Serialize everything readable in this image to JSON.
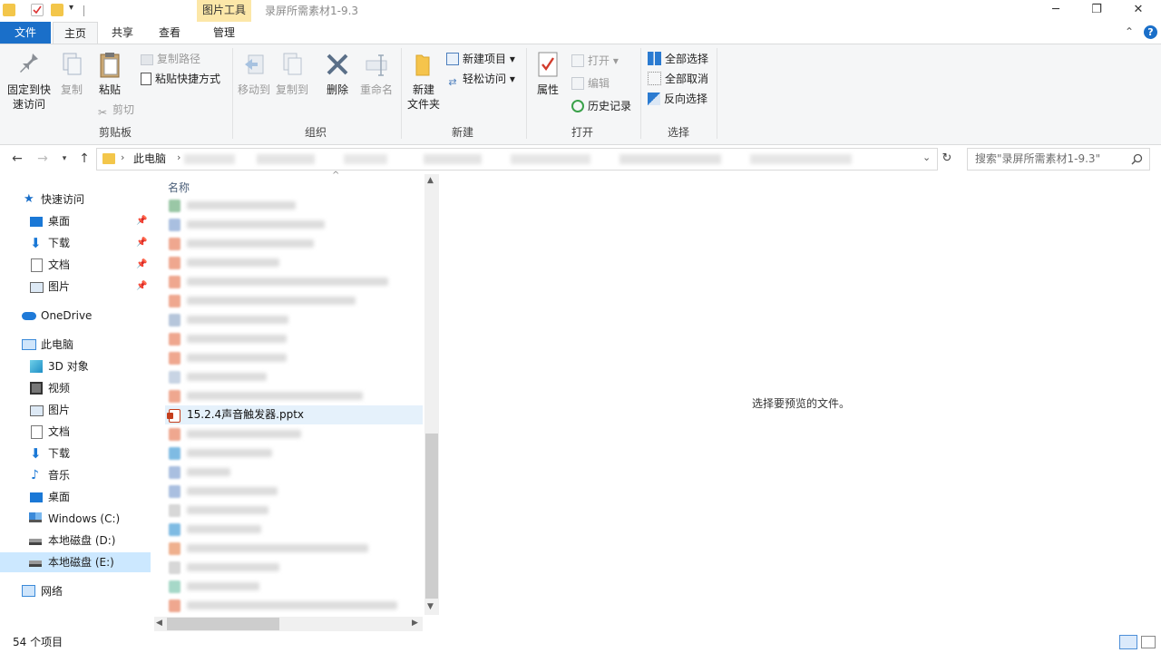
{
  "titlebar": {
    "context_tab": "图片工具",
    "title": "录屏所需素材1-9.3",
    "minimize": "─",
    "maximize": "❐",
    "close": "✕"
  },
  "tabs": {
    "file": "文件",
    "home": "主页",
    "share": "共享",
    "view": "查看",
    "manage": "管理",
    "collapse": "⌃",
    "help": "?"
  },
  "ribbon": {
    "clipboard": {
      "pin": "固定到快速访问",
      "pin_line1": "固定到快",
      "pin_line2": "速访问",
      "copy": "复制",
      "paste": "粘贴",
      "copy_path": "复制路径",
      "paste_shortcut": "粘贴快捷方式",
      "cut": "剪切",
      "label": "剪贴板"
    },
    "organize": {
      "move_to": "移动到",
      "copy_to": "复制到",
      "delete": "删除",
      "rename": "重命名",
      "label": "组织"
    },
    "new": {
      "new_folder_line1": "新建",
      "new_folder_line2": "文件夹",
      "new_item": "新建项目",
      "easy_access": "轻松访问",
      "label": "新建"
    },
    "open": {
      "properties": "属性",
      "open": "打开",
      "edit": "编辑",
      "history": "历史记录",
      "label": "打开"
    },
    "select": {
      "select_all": "全部选择",
      "select_none": "全部取消",
      "invert": "反向选择",
      "label": "选择"
    }
  },
  "address": {
    "this_pc": "此电脑",
    "search_placeholder": "搜索\"录屏所需素材1-9.3\""
  },
  "nav": {
    "quick_access": "快速访问",
    "quick_items": [
      "桌面",
      "下载",
      "文档",
      "图片"
    ],
    "onedrive": "OneDrive",
    "this_pc": "此电脑",
    "pc_items": [
      "3D 对象",
      "视频",
      "图片",
      "文档",
      "下载",
      "音乐",
      "桌面",
      "Windows (C:)",
      "本地磁盘 (D:)",
      "本地磁盘 (E:)"
    ],
    "network": "网络"
  },
  "filelist": {
    "column_name": "名称",
    "selected_file": "15.2.4声音触发器.pptx"
  },
  "preview": {
    "message": "选择要预览的文件。"
  },
  "status": {
    "count": "54 个项目"
  },
  "colors": {
    "accent": "#1a6fc9",
    "selection": "#e5f1fb",
    "ribbon_bg": "#f5f6f7",
    "context_tab": "#fce7a8"
  }
}
